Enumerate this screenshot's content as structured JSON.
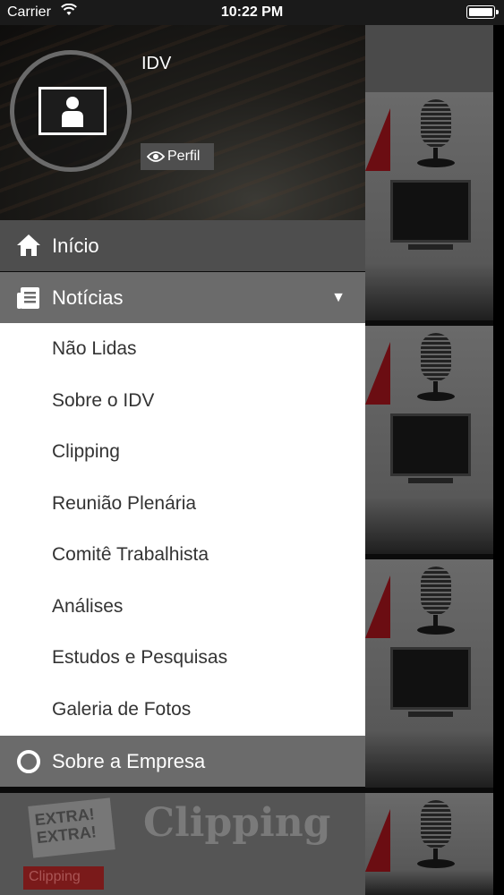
{
  "status_bar": {
    "carrier": "Carrier",
    "time": "10:22 PM"
  },
  "drawer": {
    "user_name": "IDV",
    "profile_button": "Perfil",
    "menu": {
      "inicio": "Início",
      "noticias": "Notícias",
      "sobre_empresa": "Sobre a Empresa"
    },
    "submenu": [
      "Não Lidas",
      "Sobre o IDV",
      "Clipping",
      "Reunião Plenária",
      "Comitê Trabalhista",
      "Análises",
      "Estudos e Pesquisas",
      "Galeria de Fotos"
    ]
  },
  "background": {
    "clipping_text": "Clipping",
    "extra_text": "EXTRA! EXTRA!",
    "clipping_tag": "Clipping"
  },
  "icons": [
    "wifi-icon",
    "battery-icon",
    "user-placeholder-icon",
    "eye-icon",
    "home-icon",
    "news-icon",
    "caret-down-icon",
    "circle-icon"
  ],
  "colors": {
    "menu_dark": "#4e4e4e",
    "menu_mid": "#6b6b6b",
    "submenu_bg": "#ffffff",
    "accent_red": "#6b0d12"
  }
}
